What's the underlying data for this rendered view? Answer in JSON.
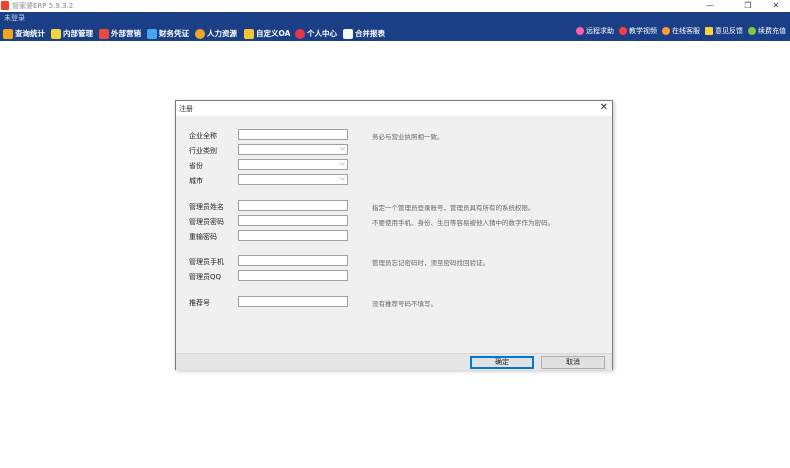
{
  "app": {
    "title": "管家婆ERP 5.9.3.2",
    "login_status": "未登录"
  },
  "window_controls": {
    "minimize": "—",
    "maximize": "❐",
    "close": "✕"
  },
  "quick_links": [
    {
      "label": "远程求助",
      "color": "#ff5fa8"
    },
    {
      "label": "教学视频",
      "color": "#ff3b3b"
    },
    {
      "label": "在线客服",
      "color": "#ff9a2f"
    },
    {
      "label": "意见反馈",
      "color": "#f7d23e"
    },
    {
      "label": "续费充值",
      "color": "#7ccb3a"
    }
  ],
  "toolbar": [
    {
      "label": "查询统计",
      "color": "#f2a31a"
    },
    {
      "label": "内部管理",
      "color": "#f5d53c"
    },
    {
      "label": "外部营销",
      "color": "#e84b3c"
    },
    {
      "label": "财务凭证",
      "color": "#4aa3f0"
    },
    {
      "label": "人力资源",
      "color": "#f6a623"
    },
    {
      "label": "自定义OA",
      "color": "#f3c531"
    },
    {
      "label": "个人中心",
      "color": "#e8374a"
    },
    {
      "label": "合并报表",
      "color": "#f6f6f6"
    }
  ],
  "dialog": {
    "title": "注册",
    "fields": {
      "company_name": {
        "label": "企业全称",
        "value": "",
        "hint": "务必与营业执照相一致。"
      },
      "industry": {
        "label": "行业类别",
        "value": ""
      },
      "province": {
        "label": "省份",
        "value": ""
      },
      "city": {
        "label": "城市",
        "value": ""
      },
      "admin_name": {
        "label": "管理员姓名",
        "value": "",
        "hint": "指定一个管理员登录账号，管理员具有所有的系统权限。"
      },
      "admin_password": {
        "label": "管理员密码",
        "value": "",
        "hint": "不要使用手机、身份、生日等容易被他人猜中的数字作为密码。"
      },
      "confirm_password": {
        "label": "重输密码",
        "value": ""
      },
      "admin_phone": {
        "label": "管理员手机",
        "value": "",
        "hint": "管理员忘记密码时，须至密码找回验证。"
      },
      "admin_qq": {
        "label": "管理员QQ",
        "value": ""
      },
      "referral": {
        "label": "推荐号",
        "value": "",
        "hint": "没有推荐号码不填写。"
      }
    },
    "buttons": {
      "ok": "确定",
      "cancel": "取消"
    }
  }
}
